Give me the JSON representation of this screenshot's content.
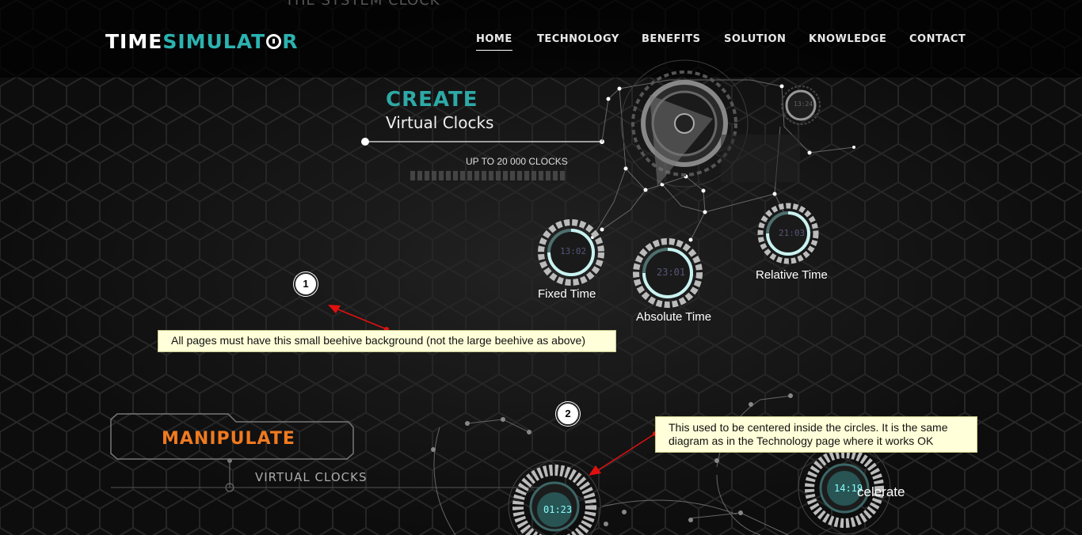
{
  "brand": {
    "part1": "TIME",
    "part2": "SIMULAT",
    "part3": "R",
    "accent": "#2bb3b0"
  },
  "nav": {
    "items": [
      {
        "label": "HOME",
        "active": true
      },
      {
        "label": "TECHNOLOGY",
        "active": false
      },
      {
        "label": "BENEFITS",
        "active": false
      },
      {
        "label": "SOLUTION",
        "active": false
      },
      {
        "label": "KNOWLEDGE",
        "active": false
      },
      {
        "label": "CONTACT",
        "active": false
      }
    ]
  },
  "ghost_heading": "THE SYSTEM CLOCK",
  "hero": {
    "title": "CREATE",
    "subtitle": "Virtual Clocks",
    "capacity": "UP TO 20 000 CLOCKS"
  },
  "clocks": {
    "fixed": {
      "label": "Fixed Time",
      "display": "13:02"
    },
    "absolute": {
      "label": "Absolute Time",
      "display": "23:01"
    },
    "relative": {
      "label": "Relative Time",
      "display": "21:03"
    },
    "top_small": {
      "display": "13:24"
    }
  },
  "annotations": {
    "one": {
      "number": "1",
      "text": "All pages must have this small beehive background (not the large beehive as above)"
    },
    "two": {
      "number": "2",
      "text": "This used to be centered inside the circles. It is the same diagram as in the Technology page where it works OK"
    }
  },
  "manipulate": {
    "title": "MANIPULATE",
    "subtitle": "VIRTUAL CLOCKS",
    "left_dial": "01:23",
    "right_dial": "14:19",
    "accelerate": "celerate",
    "accent": "#f07a1f"
  },
  "colors": {
    "teal": "#2ea9a6",
    "callout_bg": "#ffffd9",
    "arrow": "#e01010"
  }
}
